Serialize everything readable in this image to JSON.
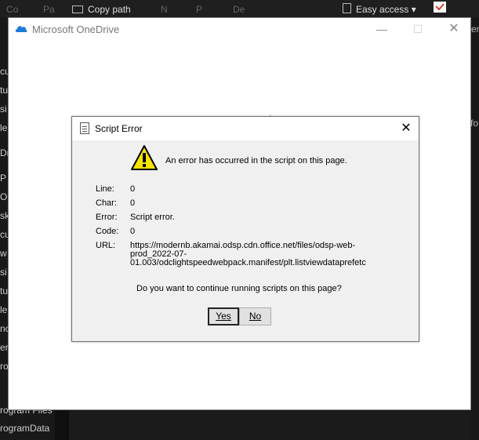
{
  "ribbon": {
    "copy_path": "Copy path",
    "easy_access": "Easy access",
    "easy_access_arrow": "▾",
    "frag_co": "Co",
    "frag_pa": "Pa",
    "frag_n": "N",
    "frag_p": "P",
    "frag_de": "De"
  },
  "sidebar": {
    "items": [
      "cu",
      "tu",
      "si",
      "le",
      "Dr",
      "P",
      "O",
      "sk",
      "cu",
      "w",
      "si",
      "tu",
      "le",
      "nc",
      "er",
      "ro",
      "rogram Files",
      "rogramData"
    ]
  },
  "right_edge": {
    "frag_fo": "fo",
    "frag_en": "en"
  },
  "onedrive": {
    "title": "Microsoft OneDrive",
    "minimize": "—",
    "maximize": "☐",
    "close": "✕"
  },
  "dialog": {
    "title": "Script Error",
    "close": "✕",
    "message": "An error has occurred in the script on this page.",
    "fields": [
      {
        "label": "Line:",
        "value": "0"
      },
      {
        "label": "Char:",
        "value": "0"
      },
      {
        "label": "Error:",
        "value": "Script error."
      },
      {
        "label": "Code:",
        "value": "0"
      }
    ],
    "url_label": "URL:",
    "url_lines": [
      "https://modernb.akamai.odsp.cdn.office.net/files/odsp-web-",
      "prod_2022-07-",
      "01.003/odclightspeedwebpack.manifest/plt.listviewdataprefetc"
    ],
    "question": "Do you want to continue running scripts on this page?",
    "yes_label": "Yes",
    "no_label": "No",
    "icon": "warning-icon"
  },
  "colors": {
    "onedrive_blue": "#1e7bd8",
    "warning_yellow": "#f7e200",
    "dark_background": "#1b1b1b"
  }
}
